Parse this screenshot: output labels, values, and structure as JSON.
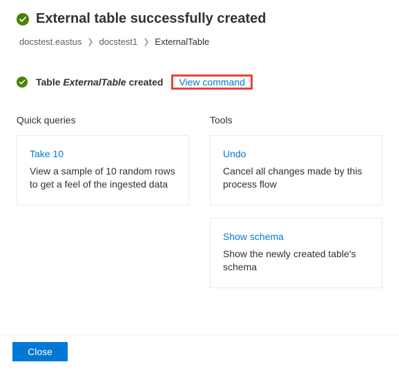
{
  "header": {
    "title": "External table successfully created"
  },
  "breadcrumb": {
    "items": [
      "docstest.eastus",
      "docstest1",
      "ExternalTable"
    ]
  },
  "status": {
    "prefix": "Table ",
    "table_name": "ExternalTable",
    "suffix": " created",
    "view_command": "View command"
  },
  "sections": {
    "quick_queries": {
      "title": "Quick queries",
      "cards": [
        {
          "link": "Take 10",
          "desc": "View a sample of 10 random rows to get a feel of the ingested data"
        }
      ]
    },
    "tools": {
      "title": "Tools",
      "cards": [
        {
          "link": "Undo",
          "desc": "Cancel all changes made by this process flow"
        },
        {
          "link": "Show schema",
          "desc": "Show the newly created table's schema"
        }
      ]
    }
  },
  "footer": {
    "close": "Close"
  },
  "colors": {
    "link": "#0078d4",
    "success": "#498205",
    "highlight": "#e8443a"
  }
}
